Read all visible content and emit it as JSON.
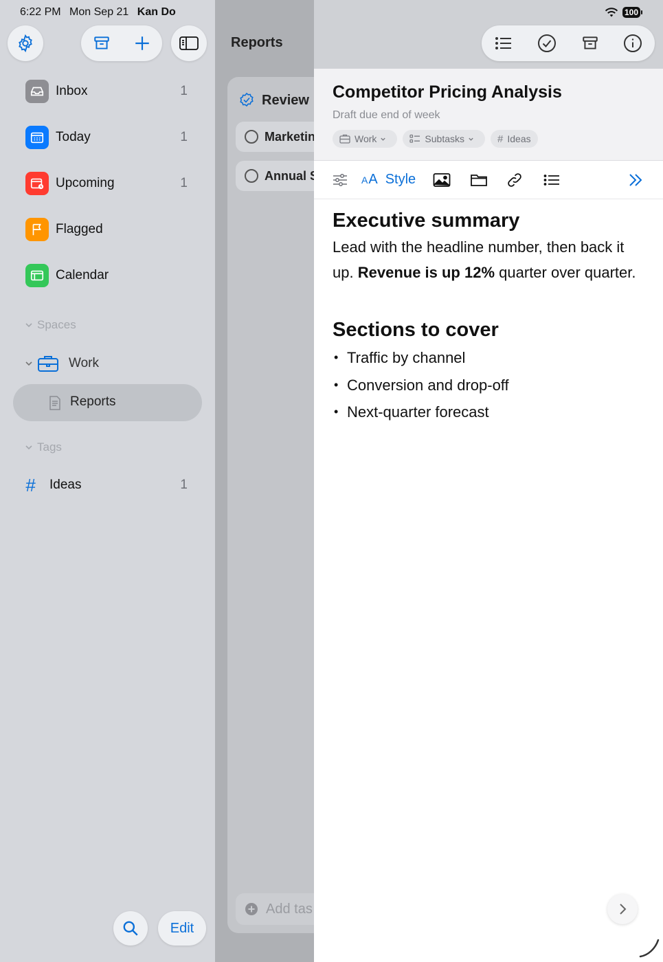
{
  "status_bar": {
    "time": "6:22 PM",
    "date": "Mon Sep 21",
    "app_name": "Kan Do",
    "battery": "100"
  },
  "sidebar": {
    "items": [
      {
        "label": "Inbox",
        "count": "1",
        "color": "#8e8e93",
        "icon": "inbox-icon"
      },
      {
        "label": "Today",
        "count": "1",
        "color": "#0a7aff",
        "icon": "calendar-today-icon"
      },
      {
        "label": "Upcoming",
        "count": "1",
        "color": "#ff3b30",
        "icon": "calendar-upcoming-icon"
      },
      {
        "label": "Flagged",
        "count": "",
        "color": "#ff9500",
        "icon": "flag-icon"
      },
      {
        "label": "Calendar",
        "count": "",
        "color": "#34c759",
        "icon": "calendar-icon"
      }
    ],
    "spaces_label": "Spaces",
    "work_label": "Work",
    "reports_label": "Reports",
    "tags_label": "Tags",
    "tag": {
      "label": "Ideas",
      "count": "1"
    },
    "edit_label": "Edit"
  },
  "middle": {
    "title": "Reports",
    "group_label": "Review",
    "tasks": [
      "Marketin",
      "Annual S"
    ],
    "add_task_placeholder": "Add tas"
  },
  "detail": {
    "title": "Competitor Pricing Analysis",
    "subtitle": "Draft due end of week",
    "chips": {
      "work": "Work",
      "subtasks": "Subtasks",
      "tag": "Ideas"
    },
    "toolbar": {
      "style_label": "Style"
    },
    "content": {
      "heading1": "Executive summary",
      "para_lead": "Lead with the headline number, then back it up.",
      "para_bold": "Revenue is up 12%",
      "para_tail": "quarter over quarter.",
      "heading2": "Sections to cover",
      "bullets": [
        "Traffic by channel",
        "Conversion and drop-off",
        "Next-quarter forecast"
      ]
    }
  },
  "colors": {
    "accent": "#0a6fd8"
  }
}
